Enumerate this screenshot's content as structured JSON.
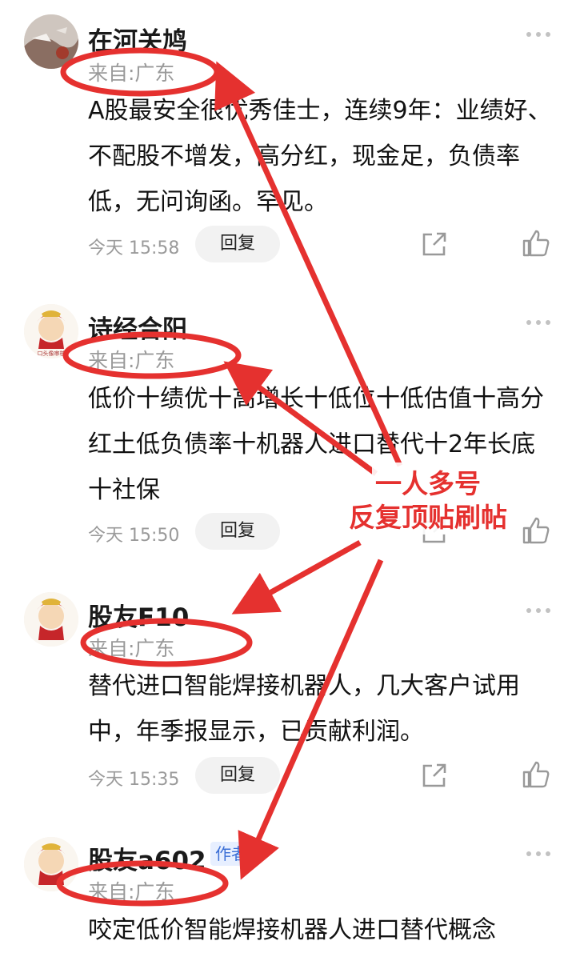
{
  "comments": [
    {
      "username": "在河关鸠",
      "location": "来自:广东",
      "text": "A股最安全很优秀佳士，连续9年：业绩好、不配股不增发，高分红，现金足，负债率低，无问询函。罕见。",
      "time": "今天 15:58",
      "reply_label": "回复"
    },
    {
      "username": "诗经合阳",
      "location": "来自:广东",
      "text": "低价十绩优十高增长十低位十低估值十高分红土低负债率十机器人进口替代十2年长底十社保",
      "time": "今天 15:50",
      "reply_label": "回复"
    },
    {
      "username": "股友F10",
      "location": "来自:广东",
      "text": "替代进口智能焊接机器人，几大客户试用中，年季报显示，已贡献利润。",
      "time": "今天 15:35",
      "reply_label": "回复"
    },
    {
      "username": "股友a602",
      "author_tag": "作者",
      "location": "来自:广东",
      "text": "咬定低价智能焊接机器人进口替代概念"
    }
  ],
  "annotation": {
    "line1": "一人多号",
    "line2": "反复顶贴刷帖",
    "color": "#e5312f"
  },
  "icons": {
    "more": "more-dots-icon",
    "share": "share-icon",
    "like": "thumbs-up-icon"
  }
}
